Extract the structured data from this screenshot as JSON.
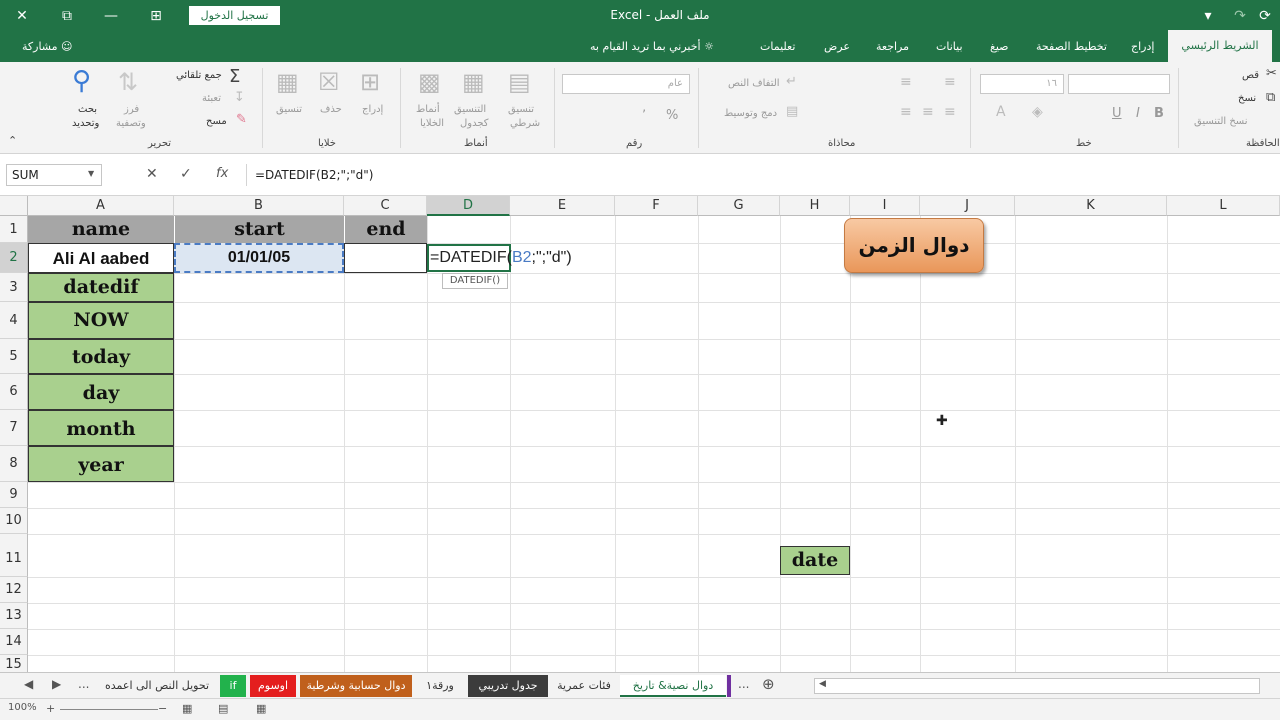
{
  "app": {
    "app_name": "Excel",
    "doc_name": "ملف العمل",
    "dash": "-",
    "signin_label": "تسجيل الدخول"
  },
  "titlebar_icons": {
    "close": "✕",
    "restore": "⧉",
    "ribbon_display": "⊞",
    "minimize": "—",
    "customize": "▾",
    "undo": "↶",
    "redo": "↷",
    "save_refresh": "⟳"
  },
  "ribbon_tabs": {
    "home": "الشريط الرئيسي",
    "insert": "إدراج",
    "page_layout": "تخطيط الصفحة",
    "formulas": "صيغ",
    "data": "بيانات",
    "review": "مراجعة",
    "view": "عرض",
    "help": "تعليمات",
    "tell_me": "أخبرني بما تريد القيام به",
    "share": "مشاركة"
  },
  "ribbon": {
    "groups": {
      "editing": "تحرير",
      "cells": "خلايا",
      "styles": "أنماط",
      "number": "رقم",
      "alignment": "محاذاة",
      "font": "خط",
      "clipboard": "الحافظة"
    },
    "editing": {
      "autosum": "جمع تلقائي",
      "fill": "تعبئة",
      "clear": "مسح",
      "sort_filter_1": "فرز",
      "sort_filter_2": "وتصفية",
      "find_select_1": "بحث",
      "find_select_2": "وتحديد"
    },
    "cells": {
      "insert": "إدراج",
      "delete": "حذف",
      "format": "تنسيق"
    },
    "styles": {
      "conditional_1": "تنسيق",
      "conditional_2": "شرطي",
      "as_table_1": "التنسيق",
      "as_table_2": "كجدول",
      "cell_styles_1": "أنماط",
      "cell_styles_2": "الخلايا"
    },
    "number": {
      "format_value": "عام",
      "percent": "%",
      "comma": "٬"
    },
    "alignment": {
      "wrap_text": "التفاف النص",
      "merge_center": "دمج وتوسيط"
    },
    "font": {
      "size_value": "١٦",
      "bold": "B",
      "italic": "I",
      "underline": "U"
    },
    "clipboard": {
      "cut": "قص",
      "copy": "نسخ",
      "format_painter": "نسخ التنسيق"
    }
  },
  "formula_bar": {
    "name_box": "SUM",
    "cancel": "✕",
    "enter": "✓",
    "fx": "fx",
    "formula": "=DATEDIF(B2;\";\"d\")"
  },
  "grid": {
    "columns": [
      "A",
      "B",
      "C",
      "D",
      "E",
      "F",
      "G",
      "H",
      "I",
      "J",
      "K",
      "L"
    ],
    "rows": [
      "1",
      "2",
      "3",
      "4",
      "5",
      "6",
      "7",
      "8",
      "9",
      "10",
      "11",
      "12",
      "13",
      "14",
      "15"
    ],
    "cells": {
      "A1": "name",
      "B1": "start",
      "C1": "end",
      "A2": "Ali Al aabed",
      "B2": "01/01/05",
      "A3": "datedif",
      "A4": "NOW",
      "A5": "today",
      "A6": "day",
      "A7": "month",
      "A8": "year",
      "H11": "date"
    },
    "editing_cell": {
      "prefix": "=DATEDIF(",
      "ref": "B2",
      "suffix": ";\";\"d\")",
      "tooltip": "DATEDIF()"
    },
    "shape_text": "دوال الزمن"
  },
  "sheet_tabs": {
    "tabs": [
      "تحويل النص الى اعمده",
      "if",
      "اوسوم",
      "دوال حسابية وشرطية",
      "ورقة١",
      "جدول تدريبي",
      "فئات عمرية",
      "دوال نصية& تاريخ"
    ],
    "more": "...",
    "add": "⊕"
  },
  "status": {
    "zoom": "100%"
  },
  "colors": {
    "excel_green": "#217346",
    "header_gray": "#a6a6a6",
    "label_green": "#a9d08e",
    "selection_blue": "#4a7bc4"
  }
}
